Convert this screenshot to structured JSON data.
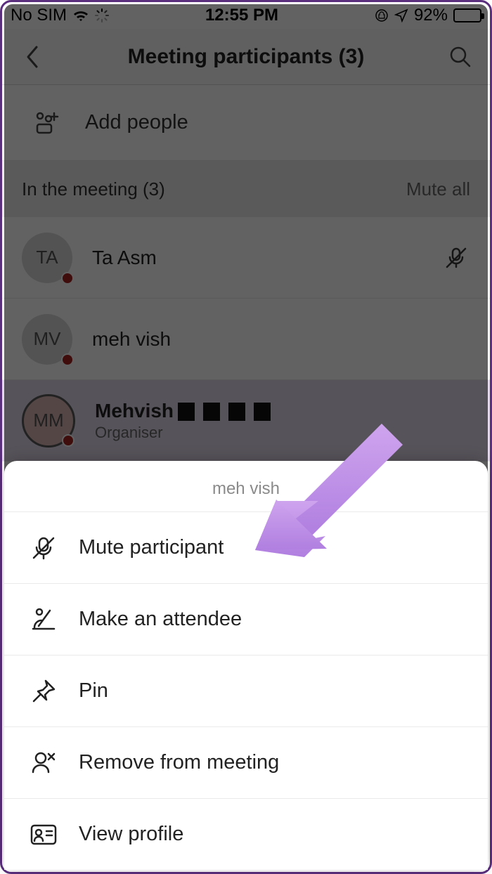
{
  "statusbar": {
    "carrier": "No SIM",
    "time": "12:55 PM",
    "battery_pct": "92%"
  },
  "header": {
    "title": "Meeting participants (3)"
  },
  "add_people": {
    "label": "Add people"
  },
  "section": {
    "title": "In the meeting (3)",
    "mute_all": "Mute all"
  },
  "participants": [
    {
      "initials": "TA",
      "name": "Ta Asm",
      "muted": true
    },
    {
      "initials": "MV",
      "name": "meh vish",
      "muted": false
    },
    {
      "initials": "MM",
      "name": "Mehvish",
      "role": "Organiser",
      "redacted_suffix": true,
      "selected": true
    }
  ],
  "sheet": {
    "subject": "meh vish",
    "items": [
      {
        "icon": "mic-off-icon",
        "label": "Mute participant"
      },
      {
        "icon": "attendee-icon",
        "label": "Make an attendee"
      },
      {
        "icon": "pin-icon",
        "label": "Pin"
      },
      {
        "icon": "remove-icon",
        "label": "Remove from meeting"
      },
      {
        "icon": "profile-icon",
        "label": "View profile"
      }
    ]
  },
  "colors": {
    "accent_purple": "#b57edc",
    "presence_busy": "#a82424"
  }
}
